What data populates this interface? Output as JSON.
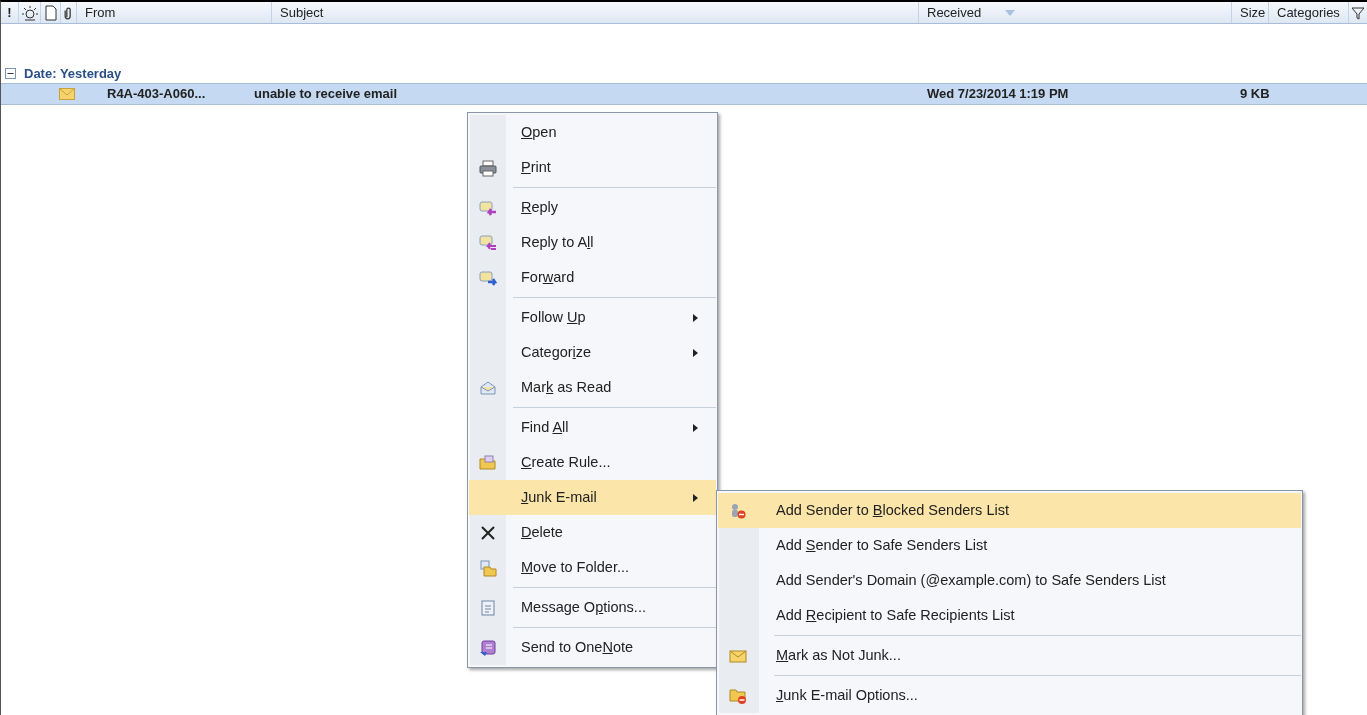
{
  "columns": [
    {
      "kind": "importance",
      "label": "!"
    },
    {
      "kind": "reminder"
    },
    {
      "kind": "icon"
    },
    {
      "kind": "attachment"
    },
    {
      "kind": "text",
      "label": "From"
    },
    {
      "kind": "text",
      "label": "Subject"
    },
    {
      "kind": "sorted",
      "label": "Received"
    },
    {
      "kind": "text",
      "label": "Size"
    },
    {
      "kind": "text",
      "label": "Categories"
    },
    {
      "kind": "filter"
    }
  ],
  "group": {
    "label": "Date: Yesterday",
    "expanded": true
  },
  "messages": [
    {
      "from": "R4A-403-A060...",
      "subject": "unable to receive email",
      "received": "Wed 7/23/2014 1:19 PM",
      "size": "9 KB",
      "selected": true,
      "unread": true
    }
  ],
  "context_menu": [
    {
      "key": "O",
      "post": "pen",
      "separator_before": false,
      "submenu": false,
      "highlighted": false
    },
    {
      "key": "P",
      "post": "rint",
      "separator_before": false,
      "submenu": false,
      "highlighted": false
    },
    {
      "key": "R",
      "post": "eply",
      "separator_before": true,
      "submenu": false,
      "highlighted": false
    },
    {
      "pre": "Reply to A",
      "key": "l",
      "post": "l",
      "separator_before": false,
      "submenu": false,
      "highlighted": false
    },
    {
      "pre": "For",
      "key": "w",
      "post": "ard",
      "separator_before": false,
      "submenu": false,
      "highlighted": false
    },
    {
      "pre": "Follow ",
      "key": "U",
      "post": "p",
      "separator_before": true,
      "submenu": true,
      "highlighted": false
    },
    {
      "pre": "Categor",
      "key": "i",
      "post": "ze",
      "separator_before": false,
      "submenu": true,
      "highlighted": false
    },
    {
      "pre": "Mar",
      "key": "k",
      "post": " as Read",
      "separator_before": false,
      "submenu": false,
      "highlighted": false
    },
    {
      "pre": "Find ",
      "key": "A",
      "post": "ll",
      "separator_before": true,
      "submenu": true,
      "highlighted": false
    },
    {
      "key": "C",
      "post": "reate Rule...",
      "separator_before": false,
      "submenu": false,
      "highlighted": false
    },
    {
      "key": "J",
      "post": "unk E-mail",
      "separator_before": false,
      "submenu": true,
      "highlighted": true
    },
    {
      "key": "D",
      "post": "elete",
      "separator_before": false,
      "submenu": false,
      "highlighted": false
    },
    {
      "key": "M",
      "post": "ove to Folder...",
      "separator_before": false,
      "submenu": false,
      "highlighted": false
    },
    {
      "pre": "Message O",
      "key": "p",
      "post": "tions...",
      "separator_before": true,
      "submenu": false,
      "highlighted": false
    },
    {
      "pre": "Send to One",
      "key": "N",
      "post": "ote",
      "separator_before": true,
      "submenu": false,
      "highlighted": false
    }
  ],
  "junk_submenu": [
    {
      "pre": "Add Sender to ",
      "key": "B",
      "post": "locked Senders List",
      "separator_before": false,
      "highlighted": true
    },
    {
      "pre": "Add ",
      "key": "S",
      "post": "ender to Safe Senders List",
      "separator_before": false,
      "highlighted": false
    },
    {
      "pre": "Add Sender's Domain (@example.com) to Safe Senders List",
      "separator_before": false,
      "highlighted": false
    },
    {
      "pre": "Add ",
      "key": "R",
      "post": "ecipient to Safe Recipients List",
      "separator_before": false,
      "highlighted": false
    },
    {
      "key": "M",
      "post": "ark as Not Junk...",
      "separator_before": true,
      "highlighted": false
    },
    {
      "key": "J",
      "post": "unk E-mail Options...",
      "separator_before": true,
      "highlighted": false
    }
  ]
}
